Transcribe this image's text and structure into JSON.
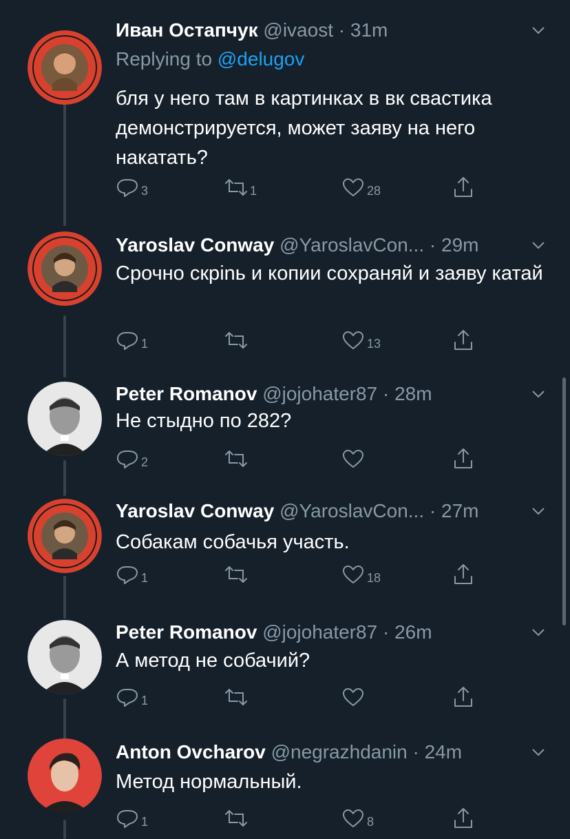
{
  "theme": {
    "background": "#15202b",
    "text": "#ffffff",
    "muted": "#8899a6",
    "link": "#1da1f2",
    "thread_line": "#38444d"
  },
  "tweets": [
    {
      "name": "Иван Остапчук",
      "handle": "@ivaost",
      "separator": "·",
      "time": "31m",
      "reply_prefix": "Replying to",
      "reply_mention": "@delugov",
      "text": "бля у него там в картинках в вк свастика демонстрируется, может заяву на него накатать?",
      "reply_count": "3",
      "retweet_count": "1",
      "like_count": "28",
      "avatar_icon": "free-mila-badge-avatar"
    },
    {
      "name": "Yaroslav Conway",
      "handle": "@YaroslavCon...",
      "separator": "·",
      "time": "29m",
      "text": "Срочно скрinь и копии сохраняй  и заяву катай",
      "reply_count": "1",
      "retweet_count": "",
      "like_count": "13",
      "avatar_icon": "free-mila-badge-avatar"
    },
    {
      "name": "Peter Romanov",
      "handle": "@jojohater87",
      "separator": "·",
      "time": "28m",
      "text": "Не стыдно по 282?",
      "reply_count": "2",
      "retweet_count": "",
      "like_count": "",
      "avatar_icon": "portrait-avatar"
    },
    {
      "name": "Yaroslav Conway",
      "handle": "@YaroslavCon...",
      "separator": "·",
      "time": "27m",
      "text": "Собакам собачья участь.",
      "reply_count": "1",
      "retweet_count": "",
      "like_count": "18",
      "avatar_icon": "free-mila-badge-avatar"
    },
    {
      "name": "Peter Romanov",
      "handle": "@jojohater87",
      "separator": "·",
      "time": "26m",
      "text": "А метод не собачий?",
      "reply_count": "1",
      "retweet_count": "",
      "like_count": "",
      "avatar_icon": "portrait-avatar"
    },
    {
      "name": "Anton Ovcharov",
      "handle": "@negrazhdanin",
      "separator": "·",
      "time": "24m",
      "text": "Метод нормальный.",
      "reply_count": "1",
      "retweet_count": "",
      "like_count": "8",
      "avatar_icon": "red-background-avatar"
    }
  ],
  "icons": {
    "reply": "reply-icon",
    "retweet": "retweet-icon",
    "like": "like-icon",
    "share": "share-icon",
    "menu": "chevron-down-icon"
  }
}
